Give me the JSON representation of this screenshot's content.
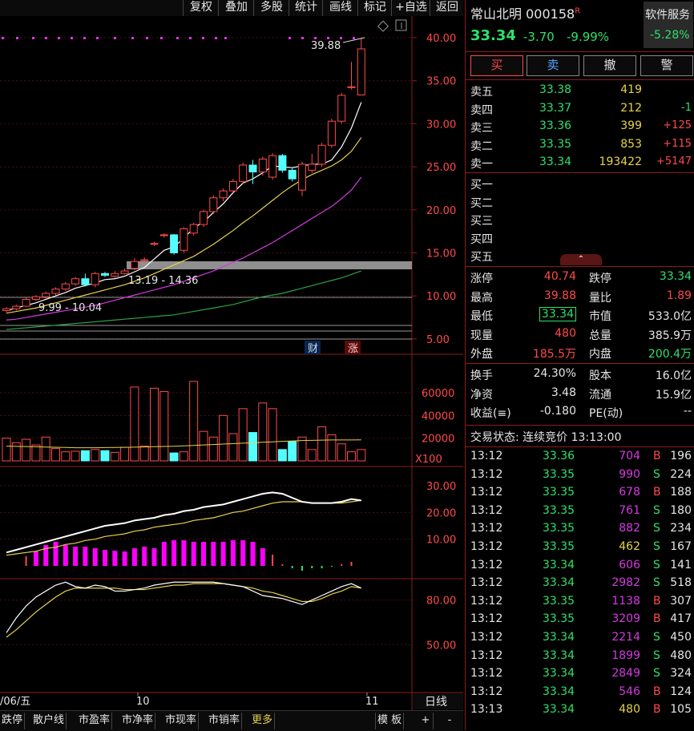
{
  "toolbar": {
    "items": [
      "复权",
      "叠加",
      "多股",
      "统计",
      "画线",
      "标记",
      "+自选",
      "返回"
    ]
  },
  "stock": {
    "name": "常山北明",
    "code": "000158",
    "flag": "R",
    "price": "33.34",
    "change": "-3.70",
    "change_pct": "-9.99%",
    "service_label": "软件服务",
    "service_pct": "-5.28%"
  },
  "actions": {
    "buy": "买",
    "sell": "卖",
    "cancel": "撤",
    "alert": "警"
  },
  "asks": [
    {
      "label": "卖五",
      "price": "33.38",
      "vol": "419",
      "chg": ""
    },
    {
      "label": "卖四",
      "price": "33.37",
      "vol": "212",
      "chg": "-1"
    },
    {
      "label": "卖三",
      "price": "33.36",
      "vol": "399",
      "chg": "+125"
    },
    {
      "label": "卖二",
      "price": "33.35",
      "vol": "853",
      "chg": "+115"
    },
    {
      "label": "卖一",
      "price": "33.34",
      "vol": "193422",
      "chg": "+5147"
    }
  ],
  "bids": [
    "买一",
    "买二",
    "买三",
    "买四",
    "买五"
  ],
  "collapse_icon": "chevron-up-icon",
  "stats1": [
    {
      "l": "涨停",
      "v": "40.74",
      "l2": "跌停",
      "v2": "33.34"
    },
    {
      "l": "最高",
      "v": "39.88",
      "l2": "量比",
      "v2": "1.89"
    },
    {
      "l": "最低",
      "v": "33.34",
      "l2": "市值",
      "v2": "533.0亿"
    },
    {
      "l": "现量",
      "v": "480",
      "l2": "总量",
      "v2": "385.9万"
    },
    {
      "l": "外盘",
      "v": "185.5万",
      "l2": "内盘",
      "v2": "200.4万"
    }
  ],
  "stats2": [
    {
      "l": "换手",
      "v": "24.30%",
      "l2": "股本",
      "v2": "16.0亿"
    },
    {
      "l": "净资",
      "v": "3.48",
      "l2": "流通",
      "v2": "15.9亿"
    },
    {
      "l": "收益(≡)",
      "v": "-0.180",
      "l2": "PE(动)",
      "v2": "--"
    }
  ],
  "trade_status": "交易状态: 连续竞价 13:13:00",
  "ticks": [
    {
      "t": "13:12",
      "p": "33.36",
      "v": "704",
      "s": "B",
      "n": "196"
    },
    {
      "t": "13:12",
      "p": "33.35",
      "v": "990",
      "s": "S",
      "n": "224"
    },
    {
      "t": "13:12",
      "p": "33.35",
      "v": "678",
      "s": "B",
      "n": "188"
    },
    {
      "t": "13:12",
      "p": "33.35",
      "v": "761",
      "s": "S",
      "n": "180"
    },
    {
      "t": "13:12",
      "p": "33.35",
      "v": "882",
      "s": "S",
      "n": "234"
    },
    {
      "t": "13:12",
      "p": "33.35",
      "v": "462",
      "s": "S",
      "n": "167"
    },
    {
      "t": "13:12",
      "p": "33.34",
      "v": "606",
      "s": "S",
      "n": "141"
    },
    {
      "t": "13:12",
      "p": "33.34",
      "v": "2982",
      "s": "S",
      "n": "518"
    },
    {
      "t": "13:12",
      "p": "33.35",
      "v": "1138",
      "s": "B",
      "n": "307"
    },
    {
      "t": "13:12",
      "p": "33.35",
      "v": "3209",
      "s": "B",
      "n": "417"
    },
    {
      "t": "13:12",
      "p": "33.34",
      "v": "2214",
      "s": "S",
      "n": "450"
    },
    {
      "t": "13:12",
      "p": "33.34",
      "v": "1899",
      "s": "S",
      "n": "480"
    },
    {
      "t": "13:12",
      "p": "33.34",
      "v": "2849",
      "s": "S",
      "n": "324"
    },
    {
      "t": "13:12",
      "p": "33.34",
      "v": "546",
      "s": "B",
      "n": "124"
    },
    {
      "t": "13:13",
      "p": "33.34",
      "v": "480",
      "s": "B",
      "n": "105"
    }
  ],
  "chart": {
    "price_ticks": [
      "40.00",
      "35.00",
      "30.00",
      "25.00",
      "20.00",
      "15.00",
      "10.00",
      "5.00"
    ],
    "annotations": {
      "high": "39.88",
      "zone1": "13.19 - 14.36",
      "zone2": "9.99 - 10.04",
      "cai": "财",
      "zhang": "涨"
    },
    "vol_ticks": [
      "60000",
      "40000",
      "20000"
    ],
    "vol_unit": "X100",
    "macd_ticks": [
      "30.00",
      "20.00",
      "10.00"
    ],
    "kdj_ticks": [
      "80.00",
      "50.00"
    ],
    "date_labels": [
      "/06/五",
      "10",
      "11"
    ],
    "period": "日线"
  },
  "bottom_tabs": [
    "跌停",
    "散户线",
    "市盈率",
    "市净率",
    "市现率",
    "市销率",
    "更多"
  ],
  "bottom_right": {
    "template": "模 板",
    "plus": "+",
    "minus": "-"
  },
  "chart_data": {
    "type": "candlestick",
    "ylim": [
      5,
      40
    ],
    "candles": [
      {
        "o": 8.3,
        "c": 8.5,
        "h": 8.7,
        "l": 8.1
      },
      {
        "o": 8.5,
        "c": 8.8,
        "h": 9.0,
        "l": 8.3
      },
      {
        "o": 8.8,
        "c": 9.6,
        "h": 9.8,
        "l": 8.7
      },
      {
        "o": 9.6,
        "c": 9.9,
        "h": 10.1,
        "l": 9.4
      },
      {
        "o": 9.9,
        "c": 10.3,
        "h": 10.5,
        "l": 9.7
      },
      {
        "o": 10.3,
        "c": 10.8,
        "h": 11.0,
        "l": 10.1
      },
      {
        "o": 10.8,
        "c": 11.4,
        "h": 11.6,
        "l": 10.6
      },
      {
        "o": 11.4,
        "c": 12.0,
        "h": 12.2,
        "l": 11.2
      },
      {
        "o": 12.0,
        "c": 11.3,
        "h": 12.6,
        "l": 11.1
      },
      {
        "o": 11.3,
        "c": 12.6,
        "h": 12.8,
        "l": 11.0
      },
      {
        "o": 12.6,
        "c": 12.4,
        "h": 12.8,
        "l": 12.2
      },
      {
        "o": 12.3,
        "c": 12.6,
        "h": 12.9,
        "l": 12.1
      },
      {
        "o": 12.6,
        "c": 12.9,
        "h": 13.2,
        "l": 12.5
      },
      {
        "o": 13.2,
        "c": 14.0,
        "h": 14.4,
        "l": 13.0
      },
      {
        "o": 14.1,
        "c": 14.2,
        "h": 14.5,
        "l": 14.0
      },
      {
        "o": 16.0,
        "c": 16.1,
        "h": 16.3,
        "l": 15.8
      },
      {
        "o": 17.0,
        "c": 17.1,
        "h": 17.3,
        "l": 16.8
      },
      {
        "o": 17.1,
        "c": 15.0,
        "h": 17.2,
        "l": 14.8
      },
      {
        "o": 15.3,
        "c": 17.8,
        "h": 18.0,
        "l": 15.0
      },
      {
        "o": 17.3,
        "c": 18.3,
        "h": 18.5,
        "l": 17.0
      },
      {
        "o": 18.3,
        "c": 19.8,
        "h": 20.0,
        "l": 18.0
      },
      {
        "o": 19.8,
        "c": 21.4,
        "h": 21.7,
        "l": 19.5
      },
      {
        "o": 21.4,
        "c": 22.2,
        "h": 22.5,
        "l": 21.0
      },
      {
        "o": 22.2,
        "c": 23.3,
        "h": 23.6,
        "l": 22.0
      },
      {
        "o": 23.3,
        "c": 25.2,
        "h": 25.5,
        "l": 23.0
      },
      {
        "o": 25.2,
        "c": 24.4,
        "h": 25.8,
        "l": 23.0
      },
      {
        "o": 24.4,
        "c": 25.9,
        "h": 26.2,
        "l": 24.0
      },
      {
        "o": 23.8,
        "c": 26.3,
        "h": 26.6,
        "l": 23.5
      },
      {
        "o": 26.3,
        "c": 24.6,
        "h": 26.5,
        "l": 24.3
      },
      {
        "o": 24.6,
        "c": 23.6,
        "h": 24.9,
        "l": 23.3
      },
      {
        "o": 22.3,
        "c": 25.3,
        "h": 25.6,
        "l": 21.6
      },
      {
        "o": 24.6,
        "c": 25.3,
        "h": 26.5,
        "l": 24.3
      },
      {
        "o": 25.3,
        "c": 27.5,
        "h": 27.8,
        "l": 25.0
      },
      {
        "o": 27.5,
        "c": 30.3,
        "h": 30.6,
        "l": 27.2
      },
      {
        "o": 30.3,
        "c": 33.3,
        "h": 33.6,
        "l": 30.0
      },
      {
        "o": 34.2,
        "c": 34.3,
        "h": 37.2,
        "l": 34.0
      },
      {
        "o": 33.34,
        "c": 38.7,
        "h": 39.88,
        "l": 33.34
      }
    ],
    "volume": [
      20000,
      16000,
      19000,
      14000,
      21000,
      11000,
      8000,
      8500,
      9000,
      10000,
      9000,
      7500,
      12000,
      65000,
      13000,
      64000,
      61000,
      7000,
      8000,
      70000,
      26000,
      21000,
      40000,
      24000,
      46000,
      25000,
      51000,
      46000,
      10000,
      17000,
      21000,
      10000,
      30000,
      23000,
      15000,
      8000,
      10000
    ],
    "ma5": [
      8.3,
      8.6,
      8.9,
      9.2,
      9.6,
      10.0,
      10.4,
      10.9,
      11.2,
      11.5,
      11.9,
      12.0,
      12.3,
      12.8,
      13.3,
      14.3,
      15.3,
      15.7,
      16.7,
      17.9,
      18.6,
      19.7,
      20.7,
      22.0,
      23.1,
      23.6,
      24.3,
      25.1,
      25.0,
      24.9,
      25.1,
      25.3,
      25.3,
      25.8,
      27.3,
      29.5,
      32.5
    ],
    "ma10": [
      8.0,
      8.2,
      8.4,
      8.6,
      8.9,
      9.2,
      9.5,
      9.8,
      10.1,
      10.4,
      10.7,
      11.0,
      11.3,
      11.7,
      12.1,
      12.6,
      13.1,
      13.6,
      14.1,
      14.6,
      15.3,
      16.0,
      16.8,
      17.6,
      18.5,
      19.3,
      20.2,
      21.1,
      22.0,
      22.8,
      23.5,
      24.1,
      24.6,
      25.1,
      25.8,
      26.8,
      28.4
    ],
    "ma20": [
      7.2,
      7.3,
      7.5,
      7.7,
      7.9,
      8.1,
      8.3,
      8.5,
      8.7,
      8.9,
      9.2,
      9.5,
      9.8,
      10.1,
      10.4,
      10.7,
      11.0,
      11.3,
      11.7,
      12.1,
      12.5,
      12.9,
      13.4,
      13.9,
      14.4,
      15.0,
      15.6,
      16.2,
      16.9,
      17.6,
      18.3,
      19.0,
      19.7,
      20.4,
      21.3,
      22.3,
      23.8
    ],
    "ma60": [
      6.1,
      6.2,
      6.3,
      6.4,
      6.5,
      6.6,
      6.7,
      6.8,
      6.9,
      7.0,
      7.1,
      7.2,
      7.3,
      7.4,
      7.5,
      7.6,
      7.7,
      7.8,
      8.0,
      8.2,
      8.4,
      8.6,
      8.8,
      9.0,
      9.3,
      9.6,
      9.9,
      10.1,
      10.3,
      10.6,
      10.9,
      11.2,
      11.5,
      11.8,
      12.1,
      12.5,
      12.9
    ],
    "vol_ma": [
      13000,
      12800,
      12600,
      12400,
      12200,
      12000,
      11800,
      11600,
      11600,
      11600,
      11700,
      11800,
      11900,
      12100,
      12300,
      12500,
      12700,
      12900,
      13200,
      13600,
      14000,
      14400,
      14800,
      15200,
      15600,
      16000,
      16400,
      16800,
      17200,
      17600,
      17900,
      18100,
      18300,
      18400,
      18400,
      18400,
      18500
    ],
    "macd_dif": [
      5,
      6,
      7,
      8,
      9,
      10,
      11,
      12,
      13,
      14,
      15,
      15.5,
      16,
      17,
      17.5,
      18,
      19,
      19.5,
      20.5,
      21,
      22,
      22.5,
      23,
      24,
      25,
      26,
      27,
      27.5,
      27,
      25.5,
      24,
      23.5,
      23.5,
      23.5,
      24,
      25,
      24.5
    ],
    "macd_dea": [
      4,
      4.5,
      5,
      5.5,
      6.5,
      7,
      8,
      8.5,
      9.5,
      10,
      11,
      11.5,
      12,
      13,
      13.5,
      14.5,
      15,
      15.5,
      16,
      17,
      17.5,
      18,
      19,
      20,
      20.5,
      21.5,
      22.5,
      23.5,
      24,
      24,
      24,
      23.5,
      23.5,
      23.5,
      23.5,
      24,
      24.5
    ],
    "macd_hist": [
      0,
      0,
      1.2,
      1.8,
      2.6,
      3.0,
      2.6,
      2.4,
      2.4,
      2.2,
      2.0,
      1.9,
      1.8,
      2.2,
      2.4,
      2.2,
      3.0,
      3.2,
      3.2,
      3.0,
      3.0,
      3.0,
      3.0,
      3.2,
      3.2,
      3.0,
      2.2,
      1.4,
      0.2,
      -0.3,
      -0.6,
      -0.3,
      -0.3,
      -0.1,
      0.2,
      0.5,
      0.0
    ],
    "kdj_k": [
      58,
      68,
      76,
      82,
      86,
      90,
      92,
      89,
      88,
      90,
      89,
      86,
      86,
      87,
      88,
      90,
      91,
      92,
      92,
      92,
      92,
      92,
      91,
      90,
      89,
      86,
      83,
      82,
      81,
      79,
      77,
      80,
      83,
      86,
      89,
      91,
      88
    ],
    "kdj_d": [
      55,
      60,
      66,
      72,
      77,
      82,
      86,
      88,
      88,
      88,
      88,
      88,
      87,
      87,
      87,
      88,
      89,
      90,
      90,
      91,
      91,
      91,
      91,
      90,
      89,
      88,
      86,
      85,
      83,
      81,
      79,
      79,
      81,
      84,
      86,
      89,
      88
    ]
  }
}
